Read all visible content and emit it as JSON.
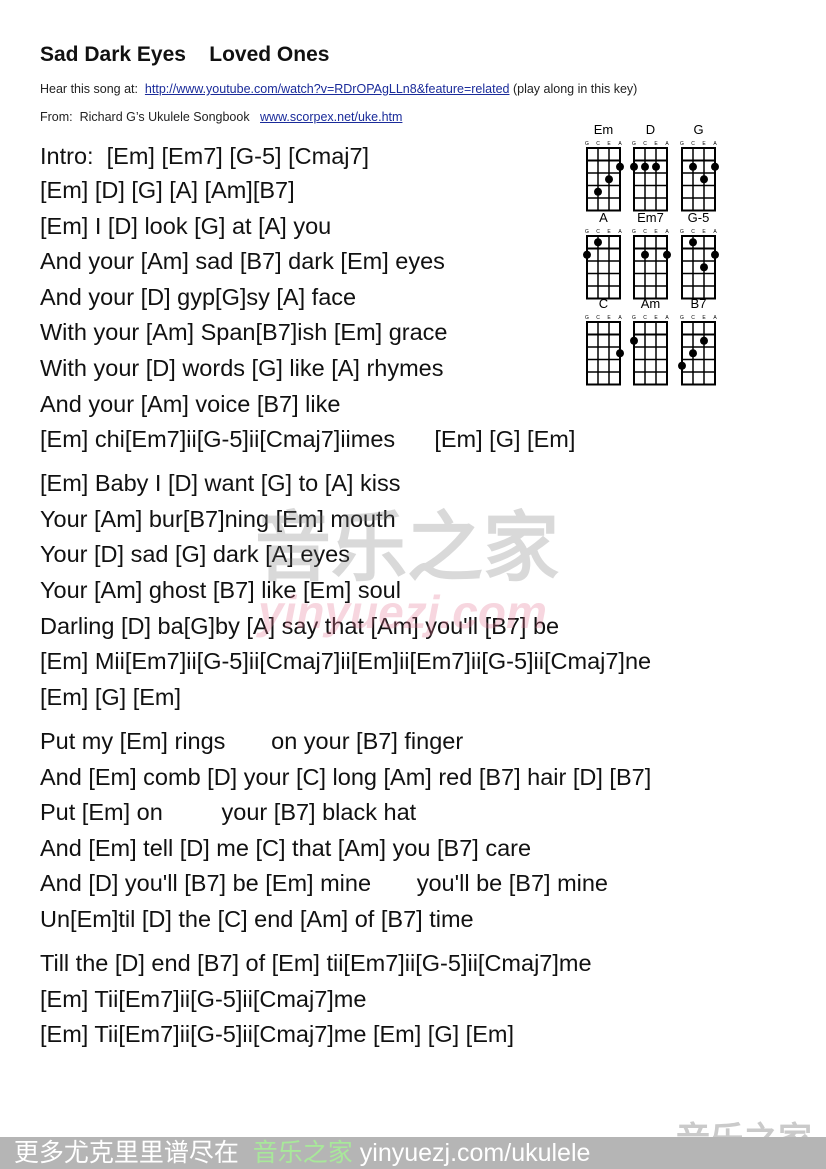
{
  "header": {
    "title": "Sad Dark Eyes    Loved Ones",
    "hear_prefix": "Hear this song at:  ",
    "hear_link": "http://www.youtube.com/watch?v=RDrOPAgLLn8&feature=related",
    "hear_suffix": " (play along in this key)",
    "from_prefix": "From:  Richard G’s Ukulele Songbook   ",
    "from_link": "www.scorpex.net/uke.htm"
  },
  "lyrics": [
    "Intro:  [Em] [Em7] [G-5] [Cmaj7]",
    "[Em] [D] [G] [A] [Am][B7]",
    "[Em] I [D] look [G] at [A] you",
    "And your [Am] sad [B7] dark [Em] eyes",
    "And your [D] gyp[G]sy [A] face",
    "With your [Am] Span[B7]ish [Em] grace",
    "With your [D] words [G] like [A] rhymes",
    "And your [Am] voice [B7] like",
    "[Em] chi[Em7]ii[G-5]ii[Cmaj7]iimes      [Em] [G] [Em]",
    "[Em] Baby I [D] want [G] to [A] kiss",
    "Your [Am] bur[B7]ning [Em] mouth",
    "Your [D] sad [G] dark [A] eyes",
    "Your [Am] ghost [B7] like [Em] soul",
    "Darling [D] ba[G]by [A] say that [Am] you'll [B7] be",
    "[Em] Mii[Em7]ii[G-5]ii[Cmaj7]ii[Em]ii[Em7]ii[G-5]ii[Cmaj7]ne",
    "[Em] [G] [Em]",
    "Put my [Em] rings       on your [B7] finger",
    "And [Em] comb [D] your [C] long [Am] red [B7] hair [D] [B7]",
    "Put [Em] on         your [B7] black hat",
    "And [Em] tell [D] me [C] that [Am] you [B7] care",
    "And [D] you'll [B7] be [Em] mine       you'll be [B7] mine",
    "Un[Em]til [D] the [C] end [Am] of [B7] time",
    "Till the [D] end [B7] of [Em] tii[Em7]ii[G-5]ii[Cmaj7]me",
    "[Em] Tii[Em7]ii[G-5]ii[Cmaj7]me",
    "[Em] Tii[Em7]ii[G-5]ii[Cmaj7]me [Em] [G] [Em]"
  ],
  "chord_diagrams": {
    "strings": [
      "G",
      "C",
      "E",
      "A"
    ],
    "chords": [
      {
        "name": "Em",
        "dots": [
          [
            1,
            4
          ],
          [
            2,
            3
          ],
          [
            3,
            2
          ]
        ]
      },
      {
        "name": "D",
        "dots": [
          [
            0,
            2
          ],
          [
            1,
            2
          ],
          [
            2,
            2
          ]
        ]
      },
      {
        "name": "G",
        "dots": [
          [
            1,
            2
          ],
          [
            3,
            2
          ],
          [
            2,
            3
          ]
        ]
      },
      {
        "name": "A",
        "dots": [
          [
            0,
            2
          ],
          [
            1,
            1
          ]
        ]
      },
      {
        "name": "Em7",
        "dots": [
          [
            1,
            2
          ],
          [
            3,
            2
          ]
        ]
      },
      {
        "name": "G-5",
        "dots": [
          [
            1,
            1
          ],
          [
            3,
            2
          ],
          [
            2,
            3
          ]
        ]
      },
      {
        "name": "C",
        "dots": [
          [
            3,
            3
          ]
        ]
      },
      {
        "name": "Am",
        "dots": [
          [
            0,
            2
          ]
        ]
      },
      {
        "name": "B7",
        "dots": [
          [
            2,
            2
          ],
          [
            1,
            3
          ],
          [
            0,
            4
          ]
        ]
      }
    ]
  },
  "watermark": {
    "cn": "音乐之家",
    "en": "yinyuezj.com"
  },
  "footer": {
    "prefix": "  更多尤克里里谱尽在  ",
    "brand": "音乐之家",
    "suffix": " yinyuezj.com/ukulele"
  }
}
